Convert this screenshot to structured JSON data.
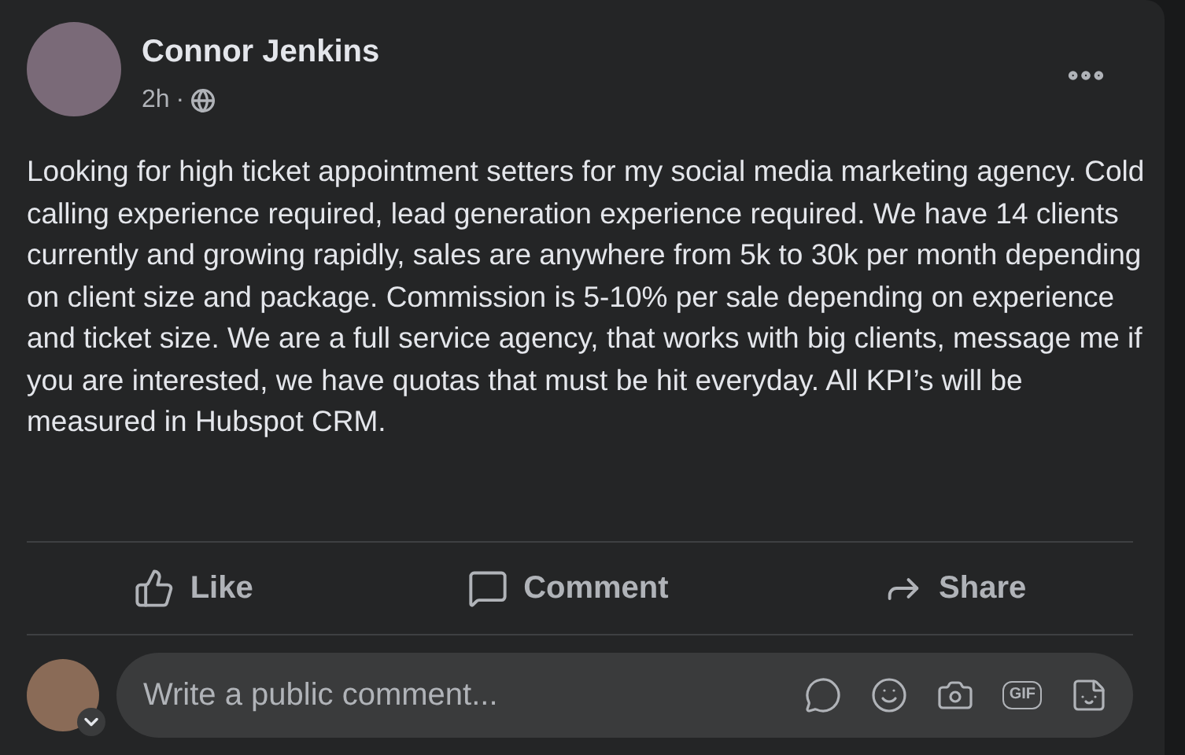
{
  "post": {
    "author": "Connor Jenkins",
    "time": "2h",
    "separator": "·",
    "body": "Looking for high ticket appointment setters for my social media marketing agency. Cold calling experience required, lead generation experience required. We have 14 clients currently and growing rapidly, sales are anywhere from 5k to 30k per month depending on client size and package. Commission is 5-10% per sale depending on experience and ticket size. We are a full service agency, that works with big clients, message me if you are interested, we have quotas that must be hit everyday. All KPI’s will be measured in Hubspot CRM."
  },
  "actions": [
    {
      "kind": "like",
      "label": "Like"
    },
    {
      "kind": "comment",
      "label": "Comment"
    },
    {
      "kind": "share",
      "label": "Share"
    }
  ],
  "comment_box": {
    "placeholder": "Write a public comment...",
    "gif_label": "GIF"
  }
}
